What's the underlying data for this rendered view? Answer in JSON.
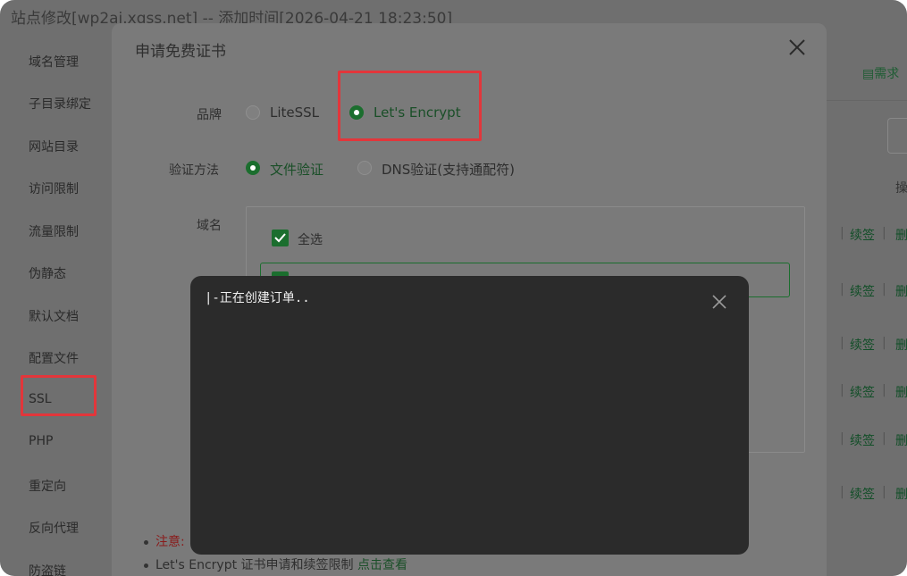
{
  "window": {
    "title": "站点修改[wp2ai.xgss.net] -- 添加时间[2026-04-21 18:23:50]"
  },
  "sidebar": {
    "items": [
      {
        "label": "域名管理"
      },
      {
        "label": "子目录绑定"
      },
      {
        "label": "网站目录"
      },
      {
        "label": "访问限制"
      },
      {
        "label": "流量限制"
      },
      {
        "label": "伪静态"
      },
      {
        "label": "默认文档"
      },
      {
        "label": "配置文件"
      },
      {
        "label": "SSL"
      },
      {
        "label": "PHP"
      },
      {
        "label": "重定向"
      },
      {
        "label": "反向代理"
      },
      {
        "label": "防盗链"
      }
    ],
    "selected": "SSL"
  },
  "background": {
    "requirement_link": "需求",
    "ops_header": "操",
    "row_links": [
      "续签",
      "删"
    ]
  },
  "modal": {
    "title": "申请免费证书",
    "brand_label": "品牌",
    "brand_options": [
      {
        "label": "LiteSSL",
        "selected": false
      },
      {
        "label": "Let's Encrypt",
        "selected": true
      }
    ],
    "verify_label": "验证方法",
    "verify_options": [
      {
        "label": "文件验证",
        "selected": true
      },
      {
        "label": "DNS验证(支持通配符)",
        "selected": false
      }
    ],
    "domain_label": "域名",
    "select_all_label": "全选",
    "notes": {
      "warning_label": "注意:",
      "limit_text": "Let's Encrypt 证书申请和续签限制",
      "limit_link": "点击查看"
    }
  },
  "console": {
    "text": "|-正在创建订单.."
  },
  "colors": {
    "accent_green": "#1b6e2e",
    "highlight_red": "#e2363b",
    "console_bg": "#2b2b2b"
  }
}
